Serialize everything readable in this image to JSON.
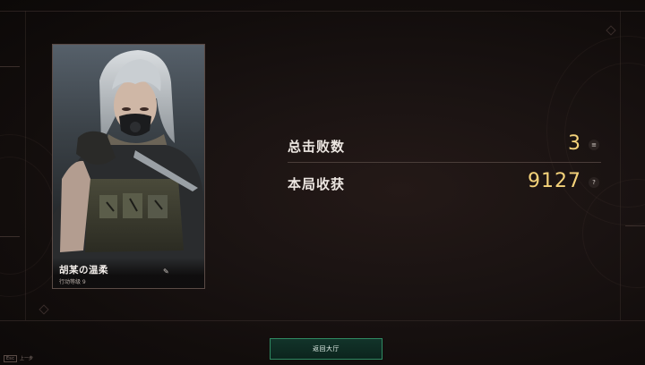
{
  "character": {
    "name": "胡某の温柔",
    "subtitle": "行动等级 9"
  },
  "stats": [
    {
      "label": "总击败数",
      "value": "3",
      "icon": "list-icon",
      "icon_glyph": "≡"
    },
    {
      "label": "本局收获",
      "value": "9127",
      "icon": "help-icon",
      "icon_glyph": "?"
    }
  ],
  "footer": {
    "return_label": "返回大厅",
    "esc_key": "Esc",
    "esc_label": "上一步"
  },
  "colors": {
    "value_gold": "#f4d27a",
    "button_green": "#2f8a62",
    "background": "#120e0d"
  }
}
